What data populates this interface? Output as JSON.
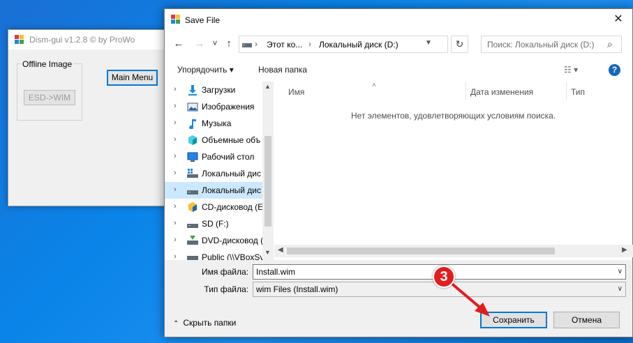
{
  "bg_window": {
    "title": "Dism-gui v1.2.8    © by ProWo",
    "group_label": "Offline Image",
    "esd_button": "ESD->WIM",
    "main_menu_button": "Main Menu"
  },
  "dialog": {
    "title": "Save File",
    "close_glyph": "✕",
    "nav": {
      "back": "←",
      "forward": "→",
      "recent": "˅",
      "up": "↑",
      "refresh": "↻"
    },
    "breadcrumb": [
      "Этот ко...",
      "Локальный диск (D:)"
    ],
    "breadcrumb_sep": "›",
    "search_placeholder": "Поиск: Локальный диск (D:)",
    "toolbar": {
      "organize": "Упорядочить ▾",
      "new_folder": "Новая папка",
      "view_glyph": "☷ ▾",
      "help": "?"
    },
    "tree": [
      {
        "label": "Загрузки",
        "icon": "downloads-icon",
        "selected": false
      },
      {
        "label": "Изображения",
        "icon": "pictures-icon",
        "selected": false
      },
      {
        "label": "Музыка",
        "icon": "music-icon",
        "selected": false
      },
      {
        "label": "Объемные объ",
        "icon": "3d-objects-icon",
        "selected": false
      },
      {
        "label": "Рабочий стол",
        "icon": "desktop-icon",
        "selected": false
      },
      {
        "label": "Локальный дис",
        "icon": "system-drive-icon",
        "selected": false
      },
      {
        "label": "Локальный дис",
        "icon": "drive-icon",
        "selected": true
      },
      {
        "label": "CD-дисковод (E",
        "icon": "cd-drive-icon",
        "selected": false
      },
      {
        "label": "SD (F:)",
        "icon": "sd-drive-icon",
        "selected": false
      },
      {
        "label": "DVD-дисковод (",
        "icon": "dvd-drive-icon",
        "selected": false
      },
      {
        "label": "Public (\\\\VBoxSv",
        "icon": "network-drive-icon",
        "selected": false
      }
    ],
    "columns": [
      "Имя",
      "Дата изменения",
      "Тип"
    ],
    "empty_message": "Нет элементов, удовлетворяющих условиям поиска.",
    "filename_label": "Имя файла:",
    "filename_value": "Install.wim",
    "filetype_label": "Тип файла:",
    "filetype_value": "wim Files (Install.wim)",
    "hide_folders": "Скрыть папки",
    "save_button": "Сохранить",
    "cancel_button": "Отмена"
  },
  "annotation": {
    "step": "3",
    "color": "#e31c1c"
  },
  "colors": {
    "accent": "#0078d7",
    "selection": "#cce8ff",
    "desktop": "#0a84e8"
  }
}
